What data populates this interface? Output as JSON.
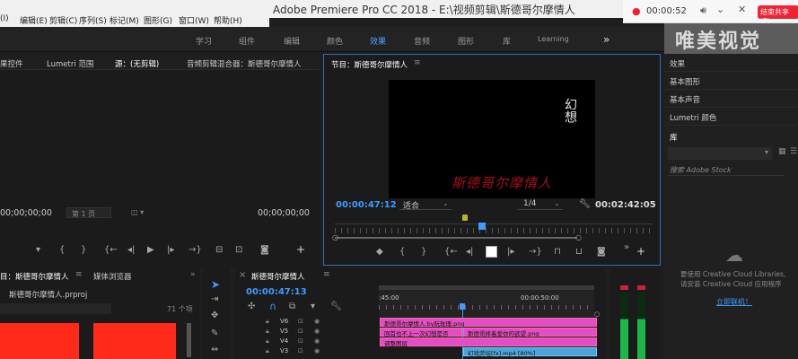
{
  "app": {
    "title": "Adobe Premiere Pro CC 2018 - E:\\视频剪辑\\斯德哥尔摩情人",
    "menu": [
      "(I)",
      "编辑(E)",
      "剪辑(C)",
      "序列(S)",
      "标记(M)",
      "图形(G)",
      "窗口(W)",
      "帮助(H)"
    ]
  },
  "player_overlay": {
    "time": "00:00:52",
    "button": "结束共享(F)"
  },
  "workspace": {
    "tabs": [
      "学习",
      "组件",
      "编辑",
      "颜色",
      "效果",
      "音频",
      "图形",
      "库",
      "Learning"
    ],
    "active": "效果",
    "more": "»"
  },
  "watermark": "唯美视觉",
  "source_panel": {
    "tabs": [
      "果控件",
      "Lumetri 范围",
      "源：(无剪辑)",
      "音频剪辑混合器：斯德哥尔摩情人"
    ],
    "timecode_left": "00;00;00;00",
    "page": "第 1 页",
    "timecode_right": "00;00;00;00"
  },
  "program_panel": {
    "title": "节目：斯德哥尔摩情人",
    "video_text_vertical": "幻想",
    "video_text_title": "斯德哥尔摩情人",
    "timecode": "00:00:47:12",
    "fit": "适合",
    "quality": "1/4",
    "duration": "00:02:42:05"
  },
  "right_panel": {
    "items": [
      "效果",
      "基本图形",
      "基本声音",
      "Lumetri 颜色",
      "库"
    ],
    "search_placeholder": "搜索 Adobe Stock",
    "cc_text1": "要使用 Creative Cloud Libraries,",
    "cc_text2": "请安装 Creative Cloud 应用程序",
    "cc_link": "立即联机！"
  },
  "project_panel": {
    "tabs": [
      "目：斯德哥尔摩情人",
      "媒体浏览器"
    ],
    "file": "斯德哥尔摩情人.prproj",
    "count": "71 个项"
  },
  "timeline": {
    "title": "斯德哥尔摩情人",
    "timecode": "00:00:47:13",
    "ruler": [
      ":45:00",
      "00:00:50:00"
    ],
    "tracks": [
      "V6",
      "V5",
      "V4",
      "V3"
    ],
    "clips": [
      {
        "label": "斯德哥尔摩情人.by阮玫瑰.png",
        "color": "pink"
      },
      {
        "label": "回首也不上一次幻想是否",
        "color": "pink"
      },
      {
        "label": "斯德哥摔着爱你的欲望.png",
        "color": "pink"
      },
      {
        "label": "调整图层",
        "color": "pink"
      },
      {
        "label": "幻戏荧坛[fx].mp4 [80%]",
        "color": "cyan"
      }
    ]
  }
}
